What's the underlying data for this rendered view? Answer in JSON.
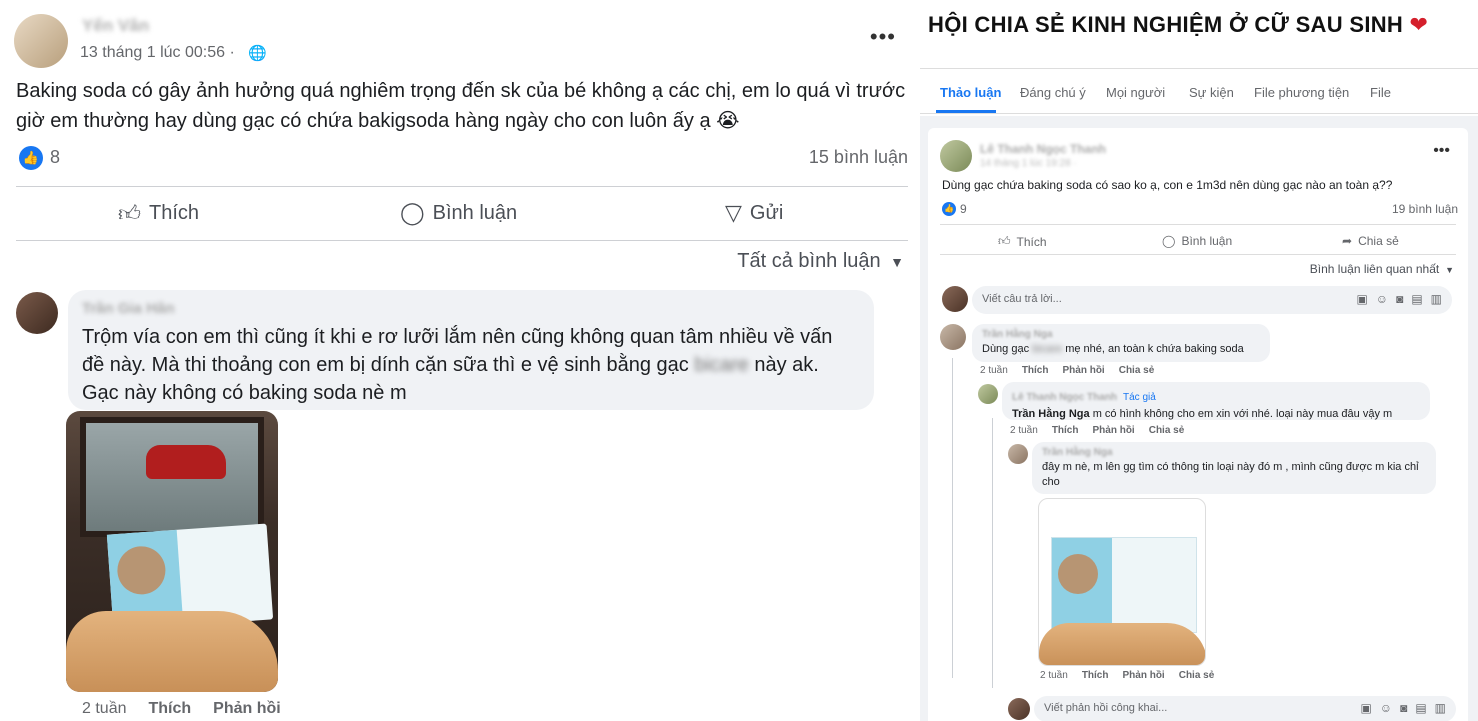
{
  "left_post": {
    "author": "Yến Vân",
    "time": "13 tháng 1 lúc 00:56 ·",
    "privacy_icon": "globe-icon",
    "more": "•••",
    "body": "Baking soda có gây ảnh hưởng quá nghiêm trọng đến sk của bé không ạ các chị, em lo quá vì trước giờ em thường hay dùng gạc có chứa bakigsoda hàng ngày cho con luôn ấy ạ 😭",
    "like_count": "8",
    "comment_count": "15 bình luận",
    "actions": {
      "like": "Thích",
      "comment": "Bình luận",
      "send": "Gửi"
    },
    "sort": "Tất cả bình luận",
    "comment": {
      "author": "Trần Gia Hân",
      "text_a": "Trộm vía con em thì cũng ít khi e rơ lưỡi lắm nên cũng không quan tâm nhiều về vấn đề này. Mà thi thoảng con em bị dính cặn sữa thì e vệ sinh bằng gạc",
      "text_blur": "bicare",
      "text_b": "này ak. Gạc này không có baking soda nè m",
      "age": "2 tuần",
      "like": "Thích",
      "reply": "Phản hồi"
    }
  },
  "right_post": {
    "group_title": "HỘI CHIA SẺ KINH NGHIỆM Ở CỮ SAU SINH",
    "heart": "❤",
    "tabs": [
      "Thảo luận",
      "Đáng chú ý",
      "Mọi người",
      "Sự kiện",
      "File phương tiện",
      "File"
    ],
    "author": "Lê Thanh Ngọc Thanh",
    "time": "14 tháng 1 lúc 19:28 ·",
    "more": "•••",
    "body": "Dùng gạc chứa baking soda có sao ko ạ, con e 1m3d nên dùng gạc nào an toàn ạ??",
    "like_count": "9",
    "comment_count": "19 bình luận",
    "actions": {
      "like": "Thích",
      "comment": "Bình luận",
      "share": "Chia sẻ"
    },
    "sort": "Bình luận liên quan nhất",
    "reply_placeholder": "Viết câu trả lời...",
    "reply2_placeholder": "Viết phản hồi công khai...",
    "comments": [
      {
        "author": "Trần Hằng Nga",
        "text_a": "Dùng gạc",
        "text_blur": "bicare",
        "text_b": "mẹ nhé, an toàn k chứa baking soda",
        "age": "2 tuần",
        "like": "Thích",
        "reply": "Phản hồi",
        "share": "Chia sẻ"
      },
      {
        "author": "Lê Thanh Ngọc Thanh",
        "badge": "Tác giả",
        "mention": "Trần Hằng Nga",
        "text": "m có hình không cho em xin với nhé. loại này mua đâu vậy m",
        "age": "2 tuần",
        "like": "Thích",
        "reply": "Phản hồi",
        "share": "Chia sẻ"
      },
      {
        "author": "Trần Hằng Nga",
        "text": "đây m nè, m lên gg tìm có thông tin loại này đó m , mình cũng được m kia chỉ cho",
        "age": "2 tuần",
        "like": "Thích",
        "reply": "Phản hồi",
        "share": "Chia sẻ"
      }
    ]
  },
  "colors": {
    "accent": "#1877f2",
    "heart": "#d4202c",
    "bubble": "#f0f2f5"
  }
}
